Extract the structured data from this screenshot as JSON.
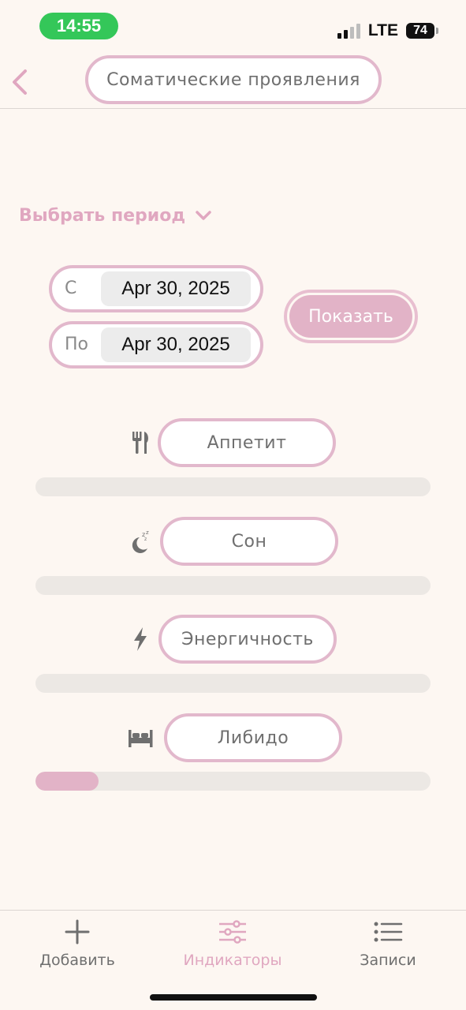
{
  "status_bar": {
    "time": "14:55",
    "network": "LTE",
    "battery": "74"
  },
  "header": {
    "title": "Соматические проявления"
  },
  "period": {
    "toggle_label": "Выбрать период",
    "from_label": "С",
    "from_value": "Apr 30, 2025",
    "to_label": "По",
    "to_value": "Apr 30, 2025",
    "show_button": "Показать"
  },
  "indicators": [
    {
      "label": "Аппетит",
      "icon": "fork-knife-icon",
      "level": 0
    },
    {
      "label": "Сон",
      "icon": "moon-sleep-icon",
      "level": 0
    },
    {
      "label": "Энергичность",
      "icon": "lightning-icon",
      "level": 0
    },
    {
      "label": "Либидо",
      "icon": "bed-icon",
      "level": 0.16
    }
  ],
  "tab_bar": {
    "items": [
      {
        "label": "Добавить",
        "icon": "plus-icon",
        "active": false
      },
      {
        "label": "Индикаторы",
        "icon": "sliders-icon",
        "active": true
      },
      {
        "label": "Записи",
        "icon": "list-icon",
        "active": false
      }
    ]
  },
  "colors": {
    "accent": "#e2b3c7",
    "pill_border": "#e2b8cc",
    "background": "#fdf7f2"
  }
}
